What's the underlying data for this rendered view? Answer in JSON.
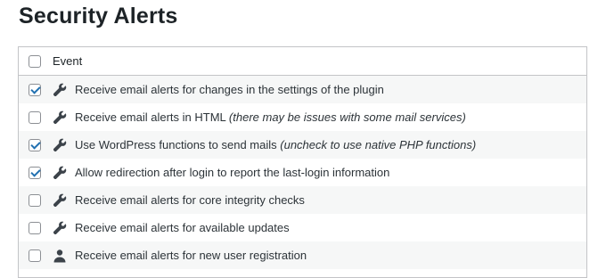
{
  "page": {
    "title": "Security Alerts"
  },
  "table": {
    "header": {
      "label": "Event",
      "checked": false
    },
    "rows": [
      {
        "label": "Receive email alerts for changes in the settings of the plugin",
        "note": "",
        "checked": true,
        "icon": "wrench-icon"
      },
      {
        "label": "Receive email alerts in HTML",
        "note": "(there may be issues with some mail services)",
        "checked": false,
        "icon": "wrench-icon"
      },
      {
        "label": "Use WordPress functions to send mails",
        "note": "(uncheck to use native PHP functions)",
        "checked": true,
        "icon": "wrench-icon"
      },
      {
        "label": "Allow redirection after login to report the last-login information",
        "note": "",
        "checked": true,
        "icon": "wrench-icon"
      },
      {
        "label": "Receive email alerts for core integrity checks",
        "note": "",
        "checked": false,
        "icon": "wrench-icon"
      },
      {
        "label": "Receive email alerts for available updates",
        "note": "",
        "checked": false,
        "icon": "wrench-icon"
      },
      {
        "label": "Receive email alerts for new user registration",
        "note": "",
        "checked": false,
        "icon": "user-icon"
      }
    ]
  },
  "colors": {
    "checkmark": "#2271b1",
    "row_alt": "#f6f7f7",
    "border": "#c3c4c7",
    "icon": "#3c434a"
  }
}
